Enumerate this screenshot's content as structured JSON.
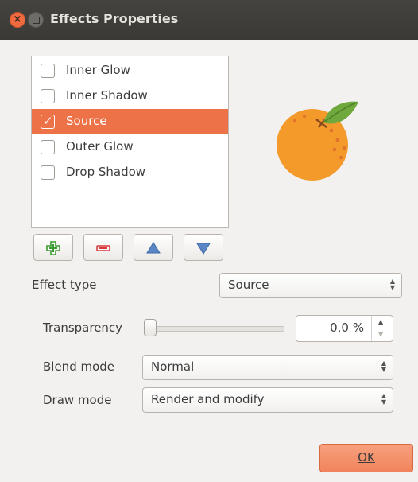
{
  "window": {
    "title": "Effects Properties"
  },
  "effects_list": [
    {
      "label": "Inner Glow",
      "checked": false,
      "selected": false
    },
    {
      "label": "Inner Shadow",
      "checked": false,
      "selected": false
    },
    {
      "label": "Source",
      "checked": true,
      "selected": true
    },
    {
      "label": "Outer Glow",
      "checked": false,
      "selected": false
    },
    {
      "label": "Drop Shadow",
      "checked": false,
      "selected": false
    }
  ],
  "list_buttons": [
    {
      "icon": "plus-icon"
    },
    {
      "icon": "minus-icon"
    },
    {
      "icon": "arrow-up-icon"
    },
    {
      "icon": "arrow-down-icon"
    }
  ],
  "effect_type": {
    "label": "Effect type",
    "value": "Source"
  },
  "transparency": {
    "label": "Transparency",
    "value": "0,0 %",
    "fraction": 0.0
  },
  "blend_mode": {
    "label": "Blend mode",
    "value": "Normal"
  },
  "draw_mode": {
    "label": "Draw mode",
    "value": "Render and modify"
  },
  "ok_button": {
    "label": "OK"
  },
  "colors": {
    "accent": "#ee7248",
    "orange_fruit": "#f39a2b",
    "leaf": "#6fa83c"
  }
}
